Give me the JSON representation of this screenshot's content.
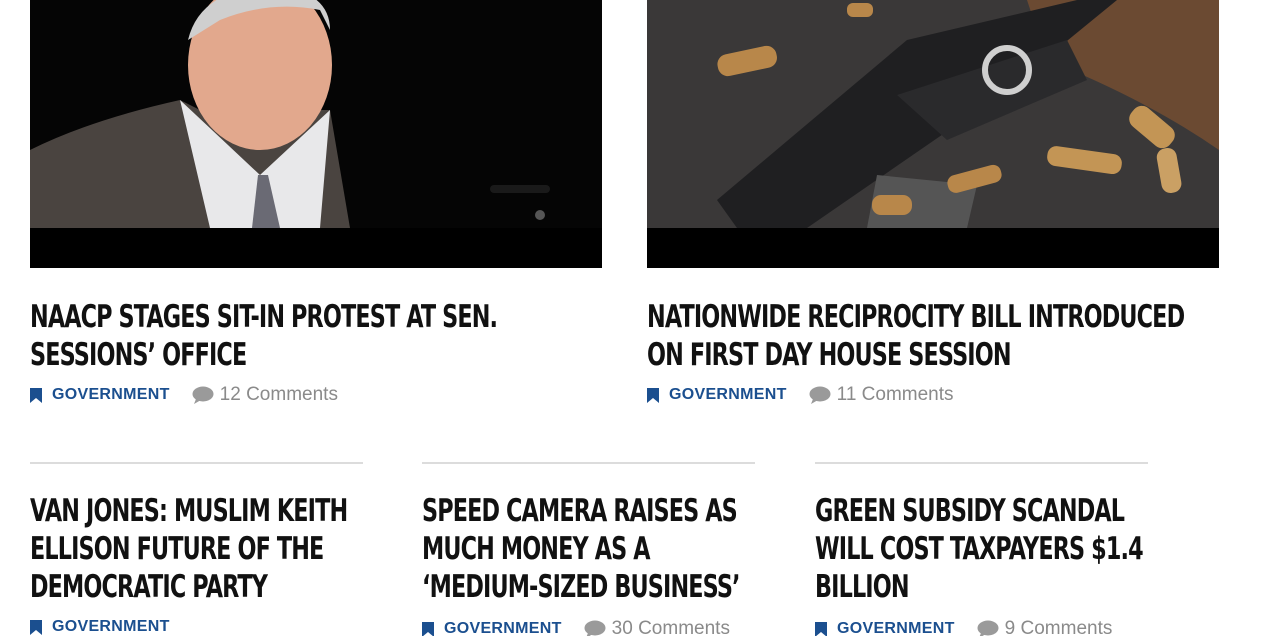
{
  "featured": [
    {
      "image_alt": "Speaker at podium",
      "title": "NAACP STAGES SIT-IN PROTEST AT SEN. SESSIONS’ OFFICE",
      "category": "GOVERNMENT",
      "comments": "12 Comments"
    },
    {
      "image_alt": "Pistol with cartridges",
      "title": "NATIONWIDE RECIPROCITY BILL INTRODUCED ON FIRST DAY HOUSE SESSION",
      "category": "GOVERNMENT",
      "comments": "11 Comments"
    }
  ],
  "articles": [
    {
      "title": "VAN JONES: MUSLIM KEITH ELLISON FUTURE OF THE DEMOCRATIC PARTY",
      "category": "GOVERNMENT",
      "comments": ""
    },
    {
      "title": "SPEED CAMERA RAISES AS MUCH MONEY AS A ‘MEDIUM-SIZED BUSINESS’",
      "category": "GOVERNMENT",
      "comments": "30 Comments"
    },
    {
      "title": "GREEN SUBSIDY SCANDAL WILL COST TAXPAYERS $1.4 BILLION",
      "category": "GOVERNMENT",
      "comments": "9 Comments"
    }
  ],
  "colors": {
    "category": "#1b4f8f",
    "comments": "#8a8a8a",
    "headline": "#111111",
    "divider": "#dcdcdc"
  },
  "icons": {
    "category": "bookmark-icon",
    "comments": "comment-bubble-icon"
  }
}
